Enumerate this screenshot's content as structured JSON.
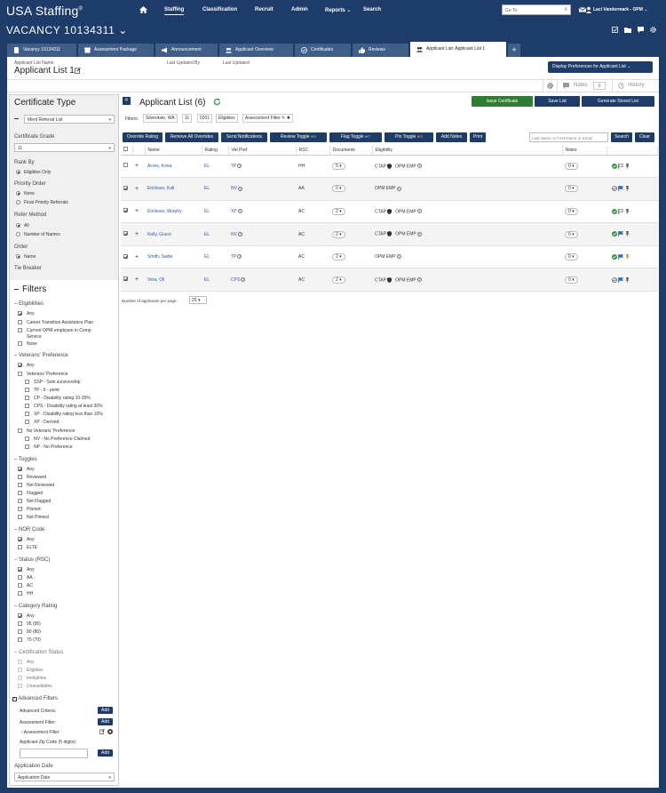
{
  "app": {
    "brand": "USA Staffing",
    "nav": [
      "Staffing",
      "Classification",
      "Recruit",
      "Admin",
      "Reports",
      "Search"
    ],
    "goto_placeholder": "Go To",
    "user": "Laci Vandermark - OPM"
  },
  "vacancy": {
    "title": "VACANCY 10134311"
  },
  "tabs": [
    "Vacancy 10134311",
    "Assessment Package",
    "Announcement",
    "Applicant Overview",
    "Certificates",
    "Reviews",
    "Applicant List: Applicant List 1"
  ],
  "header": {
    "list_name_label": "Applicant List Name",
    "list_name": "Applicant List 1",
    "updated_by_label": "Last Updated By",
    "updated_label": "Last Updated",
    "display_prefs": "Display Preferences for Applicant List",
    "notes_label": "Notes",
    "notes_count": "0",
    "history_label": "History"
  },
  "sidebar": {
    "cert_type_title": "Certificate Type",
    "cert_type_value": "Merit Referral List",
    "cert_grade_label": "Certificate Grade",
    "cert_grade_value": "11",
    "rank_by_label": "Rank By",
    "rank_by_opt": "Eligibles Only",
    "priority_label": "Priority Order",
    "priority_opts": [
      "None",
      "Float Priority Referrals"
    ],
    "refer_label": "Refer Method",
    "refer_opts": [
      "All",
      "Number of Names"
    ],
    "order_label": "Order",
    "order_opt": "Name",
    "tie_label": "Tie Breaker",
    "filters_title": "Filters",
    "elig_title": "Eligibilities",
    "elig_opts": [
      "Any",
      "Career Transition Assistance Plan",
      "Current OPM employee in Comp",
      "Service",
      "None"
    ],
    "vet_title": "Veterans' Preference",
    "vet_any": "Any",
    "vet_pref": "Veterans' Preference",
    "vet_sub": [
      "SSP - Sole survivorship",
      "TP - 5 - point",
      "CP - Disability rating 10-30%",
      "CPS - Disability rating at least 30%",
      "XP - Disability rating less than 10%",
      "XP - Derived"
    ],
    "novet": "No Veterans' Preference",
    "novet_sub": [
      "NV - No Preference Claimed",
      "NP - No Preference"
    ],
    "toggles_title": "Toggles",
    "toggles_opts": [
      "Any",
      "Reviewed",
      "Not Reviewed",
      "Flagged",
      "Not Flagged",
      "Pinned",
      "Not Pinned"
    ],
    "nor_title": "NOR Code",
    "nor_opts": [
      "Any",
      "ELTE"
    ],
    "status_title": "Status (RSC)",
    "status_opts": [
      "Any",
      "AA",
      "AC",
      "HH"
    ],
    "cat_title": "Category Rating",
    "cat_opts": [
      "Any",
      "95 (95)",
      "80 (80)",
      "70 (70)"
    ],
    "cert_status_title": "Certification Status",
    "cert_status_opts": [
      "Any",
      "Eligibles",
      "Ineligibles",
      "Unavailables"
    ],
    "adv_title": "Advanced Filters",
    "adv_criteria": "Advanced Criteria:",
    "assess_filter": "Assessment Filter:",
    "assess_filter_item": "Assessment Filter",
    "zip_label": "Applicant Zip Code (5 digits):",
    "add_label": "Add",
    "app_date_label": "Application Date",
    "app_date_value": "Application Date"
  },
  "main": {
    "title": "Applicant List (6)",
    "issue_cert": "Issue Certificate",
    "save_list": "Save List",
    "gen_list": "Generate Stored List",
    "filters_label": "Filters:",
    "filter_chips": [
      "Silverdale, WA",
      "11",
      "0201",
      "Eligibles",
      "Assessment Filter"
    ],
    "toolbar": [
      "Override Rating",
      "Remove All Overrides",
      "Send Notifications",
      "Review Toggle",
      "Flag Toggle",
      "Pin Toggle",
      "Add Notes",
      "Print"
    ],
    "search_placeholder": "Last Name or First Name or Email",
    "search_btn": "Search",
    "clear_btn": "Clear",
    "columns": [
      "Name",
      "Rating",
      "Vet Pref",
      "RSC",
      "Documents",
      "Eligibility",
      "Notes"
    ],
    "rows": [
      {
        "name": "Acres, Kona",
        "rating": "EL",
        "vet": "TP",
        "rsc": "HH",
        "docs": "5",
        "elig": [
          "CTAP",
          "OPM EMP"
        ],
        "notes": "0",
        "checked": false
      },
      {
        "name": "Erickson, Kali",
        "rating": "EL",
        "vet": "NV",
        "rsc": "AA",
        "docs": "0",
        "elig": [
          "OPM EMP"
        ],
        "notes": "0",
        "checked": true
      },
      {
        "name": "Erickson, Murphy",
        "rating": "EL",
        "vet": "XP",
        "rsc": "AC",
        "docs": "2",
        "elig": [
          "CTAP",
          "OPM EMP"
        ],
        "notes": "0",
        "checked": true
      },
      {
        "name": "Kelly, Grace",
        "rating": "EL",
        "vet": "NV",
        "rsc": "AC",
        "docs": "2",
        "elig": [
          "CTAP",
          "OPM EMP"
        ],
        "notes": "0",
        "checked": true
      },
      {
        "name": "Smith, Sadie",
        "rating": "EL",
        "vet": "TP",
        "rsc": "AC",
        "docs": "2",
        "elig": [
          "OPM EMP"
        ],
        "notes": "0",
        "checked": true
      },
      {
        "name": "Vera, Oli",
        "rating": "EL",
        "vet": "CPS",
        "rsc": "AC",
        "docs": "2",
        "elig": [
          "CTAP",
          "OPM EMP"
        ],
        "notes": "0",
        "checked": true
      }
    ],
    "per_page_label": "Number of applicants per page:",
    "per_page": "25"
  },
  "colors": {
    "navy": "#1d3c6a",
    "tab": "#3f5e88",
    "green": "#2e7d32",
    "link": "#2c5aa0"
  }
}
